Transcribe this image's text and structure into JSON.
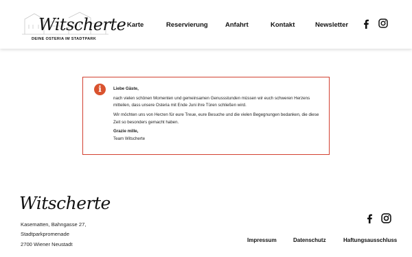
{
  "brand": {
    "name": "Witscherte",
    "tagline": "DEINE OSTERIA IM STADTPARK"
  },
  "nav": {
    "items": [
      "Karte",
      "Reservierung",
      "Anfahrt",
      "Kontakt",
      "Newsletter"
    ]
  },
  "social": {
    "icons": [
      "facebook-icon",
      "instagram-icon"
    ]
  },
  "notice": {
    "icon": "info-icon",
    "accent_color": "#d9532f",
    "border_color": "#d23f2f",
    "greeting": "Liebe Gäste,",
    "paragraph1": "nach vielen schönen Momenten und gemeinsamen Genussstunden müssen wir euch schweren Herzens mitteilen, dass unsere Osteria mit Ende Juni ihre Türen schließen wird.",
    "paragraph2": "Wir möchten uns von Herzen für eure Treue, eure Besuche und die vielen Begegnungen bedanken, die diese Zeit so besonders gemacht haben.",
    "closing": "Grazie mille,",
    "signature": "Team Witscherte"
  },
  "footer": {
    "brand": "Witscherte",
    "address": [
      "Kasematten, Bahngasse 27,",
      "Stadtparkpromenade",
      "2700 Wiener Neustadt"
    ],
    "links": [
      "Impressum",
      "Datenschutz",
      "Haftungsausschluss"
    ]
  }
}
